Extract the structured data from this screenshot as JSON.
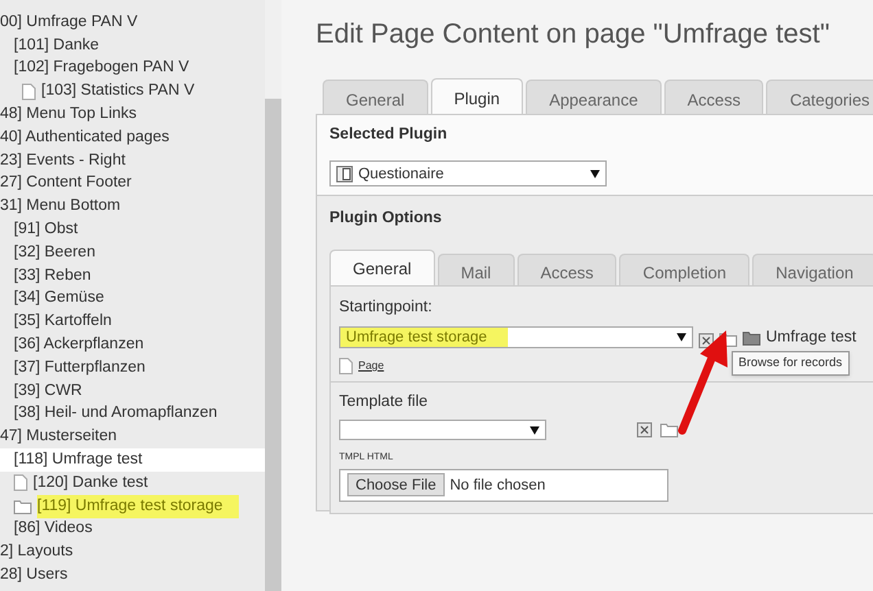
{
  "tree": [
    {
      "label": "00] Umfrage PAN V",
      "selected": false,
      "highlighted": false,
      "children": [
        {
          "label": "[101] Danke",
          "selected": false,
          "highlighted": false
        },
        {
          "label": "[102] Fragebogen PAN V",
          "selected": false,
          "highlighted": false,
          "children": [
            {
              "label": "[103] Statistics PAN V",
              "kind": "page",
              "selected": false,
              "highlighted": false
            }
          ]
        }
      ]
    },
    {
      "label": "48] Menu Top Links",
      "selected": false,
      "highlighted": false
    },
    {
      "label": "40] Authenticated pages",
      "selected": false,
      "highlighted": false
    },
    {
      "label": "23] Events - Right",
      "selected": false,
      "highlighted": false
    },
    {
      "label": "27] Content Footer",
      "selected": false,
      "highlighted": false
    },
    {
      "label": "31] Menu Bottom",
      "selected": false,
      "highlighted": false,
      "children": [
        {
          "label": "[91] Obst",
          "selected": false,
          "highlighted": false
        },
        {
          "label": "[32] Beeren",
          "selected": false,
          "highlighted": false
        },
        {
          "label": "[33] Reben",
          "selected": false,
          "highlighted": false
        },
        {
          "label": "[34] Gemüse",
          "selected": false,
          "highlighted": false
        },
        {
          "label": "[35] Kartoffeln",
          "selected": false,
          "highlighted": false
        },
        {
          "label": "[36] Ackerpflanzen",
          "selected": false,
          "highlighted": false
        },
        {
          "label": "[37] Futterpflanzen",
          "selected": false,
          "highlighted": false
        },
        {
          "label": "[39] CWR",
          "selected": false,
          "highlighted": false
        },
        {
          "label": "[38] Heil- und Aromapflanzen",
          "selected": false,
          "highlighted": false
        }
      ]
    },
    {
      "label": "47] Musterseiten",
      "selected": false,
      "highlighted": false,
      "children": [
        {
          "label": "[118] Umfrage test",
          "selected": true,
          "highlighted": false
        },
        {
          "label": "[120] Danke test",
          "kind": "page",
          "selected": false,
          "highlighted": false
        },
        {
          "label": "[119] Umfrage test storage",
          "kind": "folder",
          "selected": false,
          "highlighted": true
        },
        {
          "label": "[86] Videos",
          "selected": false,
          "highlighted": false
        }
      ]
    },
    {
      "label": "2] Layouts",
      "selected": false,
      "highlighted": false
    },
    {
      "label": "28] Users",
      "selected": false,
      "highlighted": false
    }
  ],
  "title": "Edit Page Content on page \"Umfrage test\"",
  "tabs": [
    {
      "label": "General",
      "selected": false
    },
    {
      "label": "Plugin",
      "selected": true
    },
    {
      "label": "Appearance",
      "selected": false
    },
    {
      "label": "Access",
      "selected": false
    },
    {
      "label": "Categories",
      "selected": false
    }
  ],
  "selected_plugin": {
    "heading": "Selected Plugin",
    "value": "Questionaire"
  },
  "plugin_options": {
    "heading": "Plugin Options",
    "tabs": [
      {
        "label": "General",
        "selected": true
      },
      {
        "label": "Mail",
        "selected": false
      },
      {
        "label": "Access",
        "selected": false
      },
      {
        "label": "Completion",
        "selected": false
      },
      {
        "label": "Navigation",
        "selected": false
      }
    ],
    "startingpoint": {
      "label": "Startingpoint:",
      "value": "Umfrage test storage",
      "highlighted": true,
      "record": "Umfrage test",
      "link": "Page"
    },
    "tooltip": "Browse for records",
    "template_file": {
      "label": "Template file"
    },
    "tmpl_html": {
      "label": "TMPL HTML",
      "button": "Choose File",
      "status": "No file chosen"
    }
  }
}
